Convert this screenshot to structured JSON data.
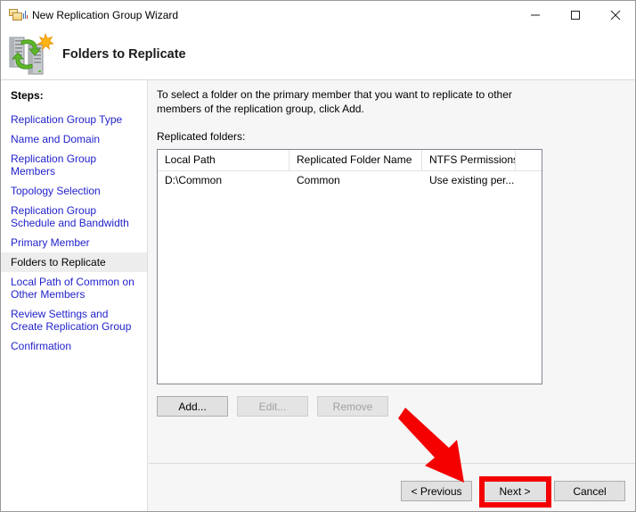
{
  "window": {
    "title": "New Replication Group Wizard",
    "title_icon": "folder-replication-icon",
    "minimize_label": "Minimize",
    "maximize_label": "Maximize",
    "close_label": "Close"
  },
  "header": {
    "title": "Folders to Replicate",
    "icon": "replication-servers-icon"
  },
  "sidebar": {
    "label": "Steps:",
    "items": [
      {
        "label": "Replication Group Type",
        "current": false
      },
      {
        "label": "Name and Domain",
        "current": false
      },
      {
        "label": "Replication Group Members",
        "current": false
      },
      {
        "label": "Topology Selection",
        "current": false
      },
      {
        "label": "Replication Group Schedule and Bandwidth",
        "current": false
      },
      {
        "label": "Primary Member",
        "current": false
      },
      {
        "label": "Folders to Replicate",
        "current": true
      },
      {
        "label": "Local Path of Common on Other Members",
        "current": false
      },
      {
        "label": "Review Settings and Create Replication Group",
        "current": false
      },
      {
        "label": "Confirmation",
        "current": false
      }
    ]
  },
  "main": {
    "intro": "To select a folder on the primary member that you want to replicate to other members of the replication group, click Add.",
    "list_label": "Replicated folders:",
    "table": {
      "columns": [
        "Local Path",
        "Replicated Folder Name",
        "NTFS Permissions",
        ""
      ],
      "rows": [
        [
          "D:\\Common",
          "Common",
          "Use existing per...",
          ""
        ]
      ]
    },
    "buttons": {
      "add": "Add...",
      "edit": "Edit...",
      "remove": "Remove"
    }
  },
  "bottom": {
    "previous": "< Previous",
    "next": "Next >",
    "cancel": "Cancel"
  },
  "annotations": {
    "highlight_color": "#f50000",
    "arrow_target": "next-button",
    "highlight_target": "next-button"
  }
}
